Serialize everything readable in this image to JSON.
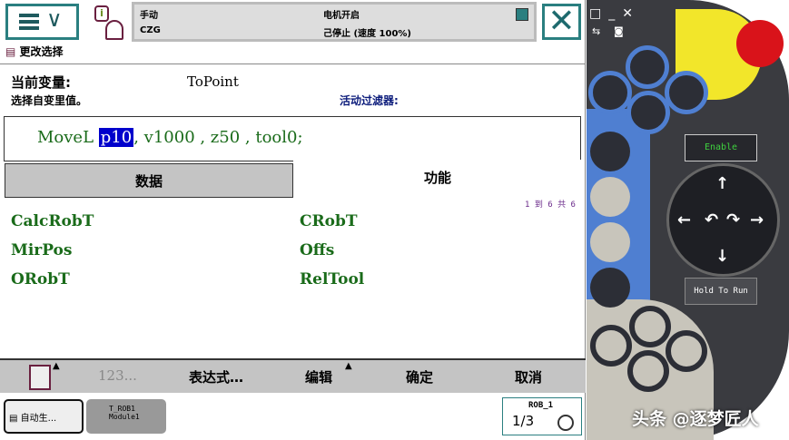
{
  "header": {
    "mode": "手动",
    "controller": "CZG",
    "motor": "电机开启",
    "state": "己停止 (速度 100%)"
  },
  "page_title": "更改选择",
  "current_variable_label": "当前变量:",
  "current_variable_value": "ToPoint",
  "instruction_hint": "选择自变里值。",
  "active_filter_label": "活动过滤器:",
  "instruction": {
    "name": "MoveL",
    "selected": "p10",
    "rest": ", v1000 , z50 , tool0;"
  },
  "tabs": [
    {
      "label": "数据"
    },
    {
      "label": "功能"
    }
  ],
  "pager": "1 到 6 共 6",
  "functions": [
    "CalcRobT",
    "CRobT",
    "MirPos",
    "Offs",
    "ORobT",
    "RelTool"
  ],
  "toolbar": {
    "numpad": "123...",
    "expression": "表达式…",
    "edit": "编辑",
    "ok": "确定",
    "cancel": "取消"
  },
  "taskbar": [
    {
      "label": "自动生..."
    },
    {
      "line1": "T_ROB1",
      "line2": "Module1"
    }
  ],
  "robot_status": {
    "name": "ROB_1",
    "fraction": "1/3"
  },
  "pendant": {
    "enable": "Enable",
    "hold": "Hold To Run"
  },
  "watermark": "头条 @逐梦匠人"
}
